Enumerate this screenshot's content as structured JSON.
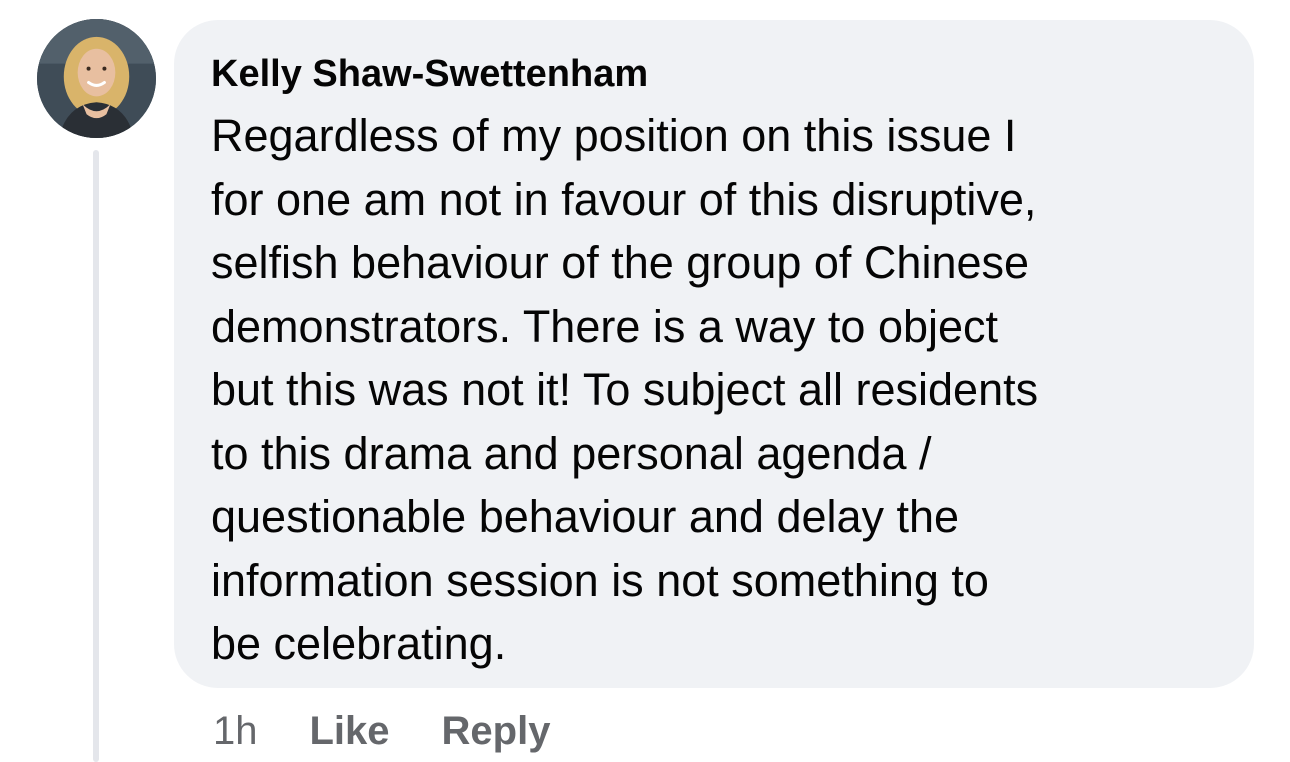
{
  "comment": {
    "author": "Kelly Shaw-Swettenham",
    "text_lines": [
      "Regardless of my position on this issue I",
      "for one am not in favour of this disruptive,",
      "selfish behaviour of the group of Chinese",
      "demonstrators. There is a way to object",
      "but this was not it! To subject all residents",
      "to this drama and personal agenda /",
      "questionable behaviour and delay the",
      "information session is not something to",
      "be celebrating."
    ],
    "timestamp": "1h",
    "like_label": "Like",
    "reply_label": "Reply"
  },
  "colors": {
    "bubble": "#f0f2f5",
    "text": "#050505",
    "secondary_text": "#65676b",
    "thread_line": "#e4e6eb"
  }
}
